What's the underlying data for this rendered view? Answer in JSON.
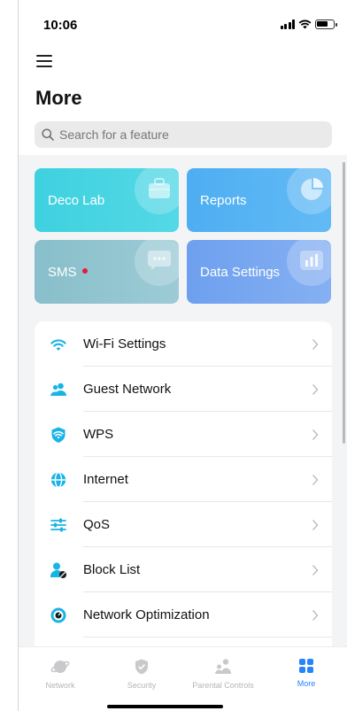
{
  "status_bar": {
    "time": "10:06"
  },
  "header": {
    "title": "More"
  },
  "search": {
    "placeholder": "Search for a feature"
  },
  "cards": [
    {
      "label": "Deco Lab",
      "icon": "toolbox-icon",
      "color": "#3ed1df"
    },
    {
      "label": "Reports",
      "icon": "pie-chart-icon",
      "color": "#4eaef2"
    },
    {
      "label": "SMS",
      "icon": "chat-bubble-icon",
      "color": "#88bfca",
      "has_badge": true
    },
    {
      "label": "Data Settings",
      "icon": "bar-chart-icon",
      "color": "#6ea0ef"
    }
  ],
  "list": {
    "items": [
      {
        "label": "Wi-Fi Settings",
        "icon": "wifi-icon"
      },
      {
        "label": "Guest Network",
        "icon": "guests-icon"
      },
      {
        "label": "WPS",
        "icon": "shield-wifi-icon"
      },
      {
        "label": "Internet",
        "icon": "globe-icon"
      },
      {
        "label": "QoS",
        "icon": "sliders-icon"
      },
      {
        "label": "Block List",
        "icon": "block-user-icon"
      },
      {
        "label": "Network Optimization",
        "icon": "optimization-icon"
      }
    ]
  },
  "tabbar": {
    "tabs": [
      {
        "label": "Network",
        "icon": "planet-icon",
        "active": false
      },
      {
        "label": "Security",
        "icon": "shield-check-icon",
        "active": false
      },
      {
        "label": "Parental Controls",
        "icon": "family-icon",
        "active": false
      },
      {
        "label": "More",
        "icon": "grid-icon",
        "active": true
      }
    ]
  },
  "colors": {
    "accent": "#2684ff",
    "icon_cyan": "#19b4e6",
    "badge_red": "#e6193d"
  }
}
